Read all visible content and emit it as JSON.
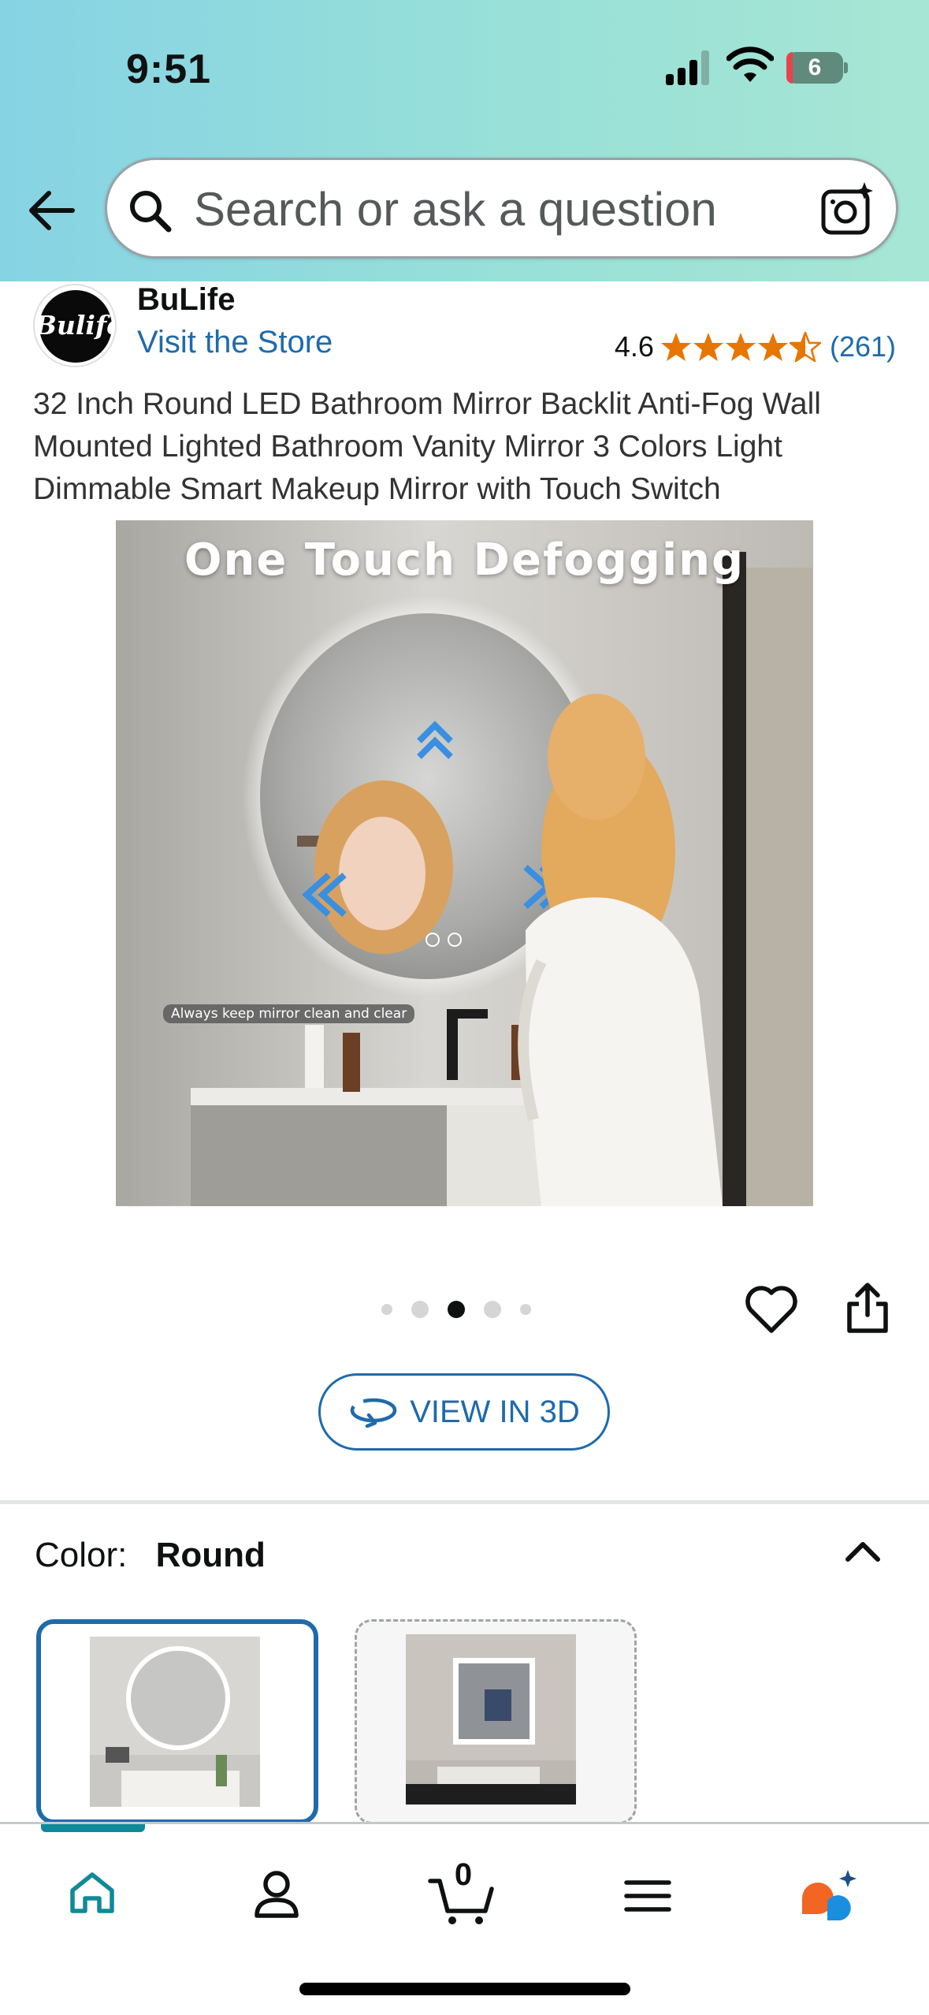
{
  "status_bar": {
    "time": "9:51",
    "battery": "6"
  },
  "search": {
    "placeholder": "Search or ask a question",
    "value": ""
  },
  "brand": {
    "logo_text": "Bulife",
    "name": "BuLife",
    "store_link": "Visit the Store"
  },
  "rating": {
    "value": "4.6",
    "stars": 4.5,
    "count": "(261)"
  },
  "product": {
    "title": "32 Inch Round LED Bathroom Mirror Backlit Anti-Fog Wall Mounted Lighted Bathroom Vanity Mirror 3 Colors Light Dimmable Smart Makeup Mirror with Touch Switch",
    "image_headline": "One Touch Defogging",
    "image_caption": "Always keep mirror clean and clear"
  },
  "carousel": {
    "total_dots": 5,
    "active_index": 2
  },
  "view3d": {
    "label": "VIEW IN 3D"
  },
  "color": {
    "label": "Color:",
    "value": "Round"
  },
  "cart": {
    "count": "0"
  },
  "colors": {
    "accent": "#1f6aaa",
    "teal": "#0e8a99",
    "star": "#e77600"
  }
}
